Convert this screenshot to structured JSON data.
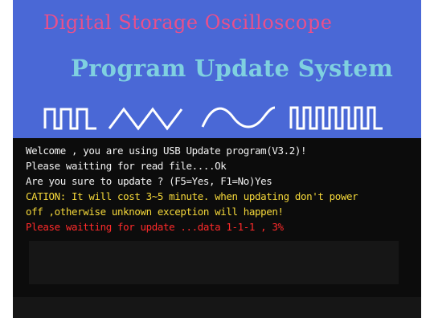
{
  "banner": {
    "title_top": "Digital Storage Oscilloscope",
    "title_main": "Program Update System",
    "colors": {
      "background": "#4a68d6",
      "title_top": "#e8508c",
      "title_main": "#7fd0e0",
      "waves": "#ffffff"
    },
    "wave_icons": [
      "pulse-wave-icon",
      "triangle-wave-icon",
      "sine-wave-icon",
      "square-wave-icon"
    ]
  },
  "console": {
    "lines": [
      {
        "text": "Welcome , you are using USB Update program(V3.2)!",
        "color": "white"
      },
      {
        "text": "Please waitting for read file....Ok",
        "color": "white"
      },
      {
        "text": "Are you sure to update ? (F5=Yes, F1=No)Yes",
        "color": "white"
      },
      {
        "text": "CATION: It will cost 3~5 minute. when updating don't power",
        "color": "yellow"
      },
      {
        "text": "off ,otherwise unknown exception will happen!",
        "color": "yellow"
      },
      {
        "text": "Please waitting for update ...data 1-1-1 , 3%",
        "color": "red"
      }
    ]
  }
}
